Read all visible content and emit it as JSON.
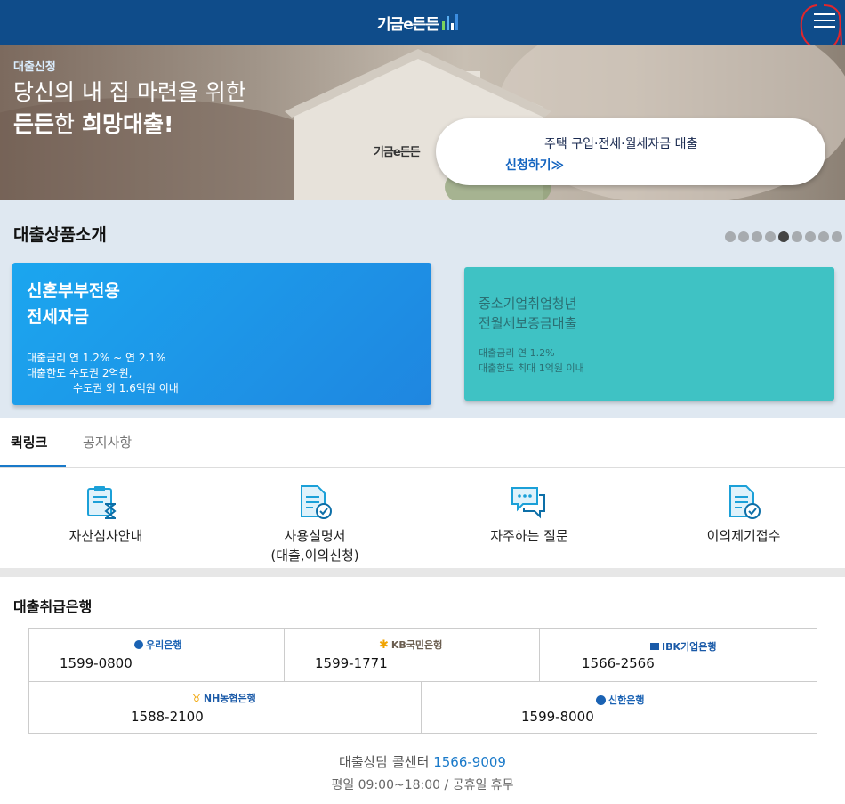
{
  "header": {
    "logo_text": "기금e든든",
    "menu_icon": "hamburger-menu-icon",
    "brand_color": "#0f4c8a"
  },
  "hero": {
    "tag": "대출신청",
    "line1": "당신의 내 집 마련을 위한",
    "line2_a": "든든",
    "line2_b": "한 ",
    "line2_c": "희망대출!",
    "house_logo": "기금e든든",
    "card_title": "주택 구입·전세·월세자금 대출",
    "card_link": "신청하기≫"
  },
  "products": {
    "title": "대출상품소개",
    "dots_total": 9,
    "dots_active_index": 4,
    "cards": [
      {
        "name_line1": "신혼부부전용",
        "name_line2": "전세자금",
        "info_line1": "대출금리 연 1.2% ~ 연 2.1%",
        "info_line2": "대출한도 수도권 2억원,",
        "info_line3": "수도권 외 1.6억원 이내"
      },
      {
        "name_line1": "중소기업취업청년",
        "name_line2": "전월세보증금대출",
        "info_line1": "대출금리 연 1.2%",
        "info_line2": "대출한도 최대 1억원 이내"
      }
    ]
  },
  "tabs": [
    {
      "label": "퀵링크",
      "active": true
    },
    {
      "label": "공지사항",
      "active": false
    }
  ],
  "quick_links": [
    {
      "label": "자산심사안내",
      "icon": "clipboard-hourglass-icon"
    },
    {
      "label": "사용설명서",
      "label2": "(대출,이의신청)",
      "icon": "document-check-icon"
    },
    {
      "label": "자주하는 질문",
      "icon": "chat-bubbles-icon"
    },
    {
      "label": "이의제기접수",
      "icon": "document-check-icon"
    }
  ],
  "banks": {
    "title": "대출취급은행",
    "items": [
      {
        "name": "우리은행",
        "phone": "1599-0800",
        "color": "#1a62b3"
      },
      {
        "name": "KB국민은행",
        "phone": "1599-1771",
        "color": "#f0a300"
      },
      {
        "name": "IBK기업은행",
        "phone": "1566-2566",
        "color": "#1a5aa8"
      },
      {
        "name": "NH농협은행",
        "phone": "1588-2100",
        "color": "#1a5aa8"
      },
      {
        "name": "신한은행",
        "phone": "1599-8000",
        "color": "#1a62b3"
      }
    ]
  },
  "footer": {
    "callcenter_label": "대출상담 콜센터",
    "callcenter_number": "1566-9009",
    "hours": "평일 09:00~18:00 / 공휴일 휴무"
  }
}
